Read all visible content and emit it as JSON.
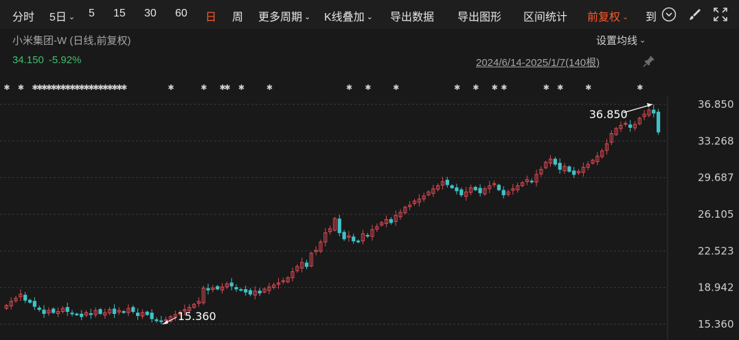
{
  "toolbar": {
    "periods": [
      "分时",
      "5日",
      "5",
      "15",
      "30",
      "60",
      "日",
      "周"
    ],
    "more_periods": "更多周期",
    "k_overlay": "K线叠加",
    "export_data": "导出数据",
    "export_chart": "导出图形",
    "range_stats": "区间统计",
    "adjust": "前复权",
    "goto": "到",
    "icons": [
      "clock-icon",
      "brush-icon",
      "fullscreen-icon"
    ]
  },
  "header": {
    "stock_name": "小米集团-W (日线,前复权)",
    "price": "34.150",
    "change_pct": "-5.92%",
    "ma_settings": "设置均线",
    "date_range": "2024/6/14-2025/1/7(140根)"
  },
  "colors": {
    "up": "#e04a55",
    "down": "#3fc3c8",
    "grid": "#3a3a3a",
    "active": "#ff5a2a",
    "change_negative": "#3fbf6f"
  },
  "chart_data": {
    "type": "candlestick",
    "title": "小米集团-W (日线,前复权)",
    "date_range": "2024/6/14-2025/1/7",
    "bar_count": 140,
    "y_ticks": [
      "36.850",
      "33.268",
      "29.687",
      "26.105",
      "22.523",
      "18.942",
      "15.360"
    ],
    "ylim": [
      15.36,
      36.85
    ],
    "grid": true,
    "annotations": [
      {
        "label": "36.850",
        "type": "high"
      },
      {
        "label": "15.360",
        "type": "low"
      }
    ],
    "closes": [
      17.2,
      17.6,
      17.9,
      18.3,
      17.7,
      17.5,
      17.1,
      16.8,
      16.4,
      16.7,
      16.5,
      16.6,
      16.9,
      16.6,
      16.4,
      16.3,
      16.1,
      16.5,
      16.3,
      16.7,
      16.4,
      16.5,
      16.8,
      16.4,
      16.7,
      16.5,
      16.9,
      16.6,
      16.2,
      16.5,
      16.3,
      15.9,
      15.7,
      15.6,
      15.8,
      16.1,
      16.3,
      16.5,
      16.8,
      17.0,
      17.3,
      17.6,
      18.9,
      18.7,
      18.9,
      18.8,
      19.0,
      19.3,
      19.1,
      18.8,
      18.7,
      18.5,
      18.3,
      18.6,
      18.4,
      18.8,
      19.0,
      19.2,
      19.4,
      19.6,
      19.9,
      20.5,
      21.0,
      21.4,
      21.0,
      22.3,
      22.6,
      23.4,
      24.3,
      24.7,
      25.7,
      24.3,
      23.7,
      24.0,
      23.5,
      23.4,
      24.2,
      24.0,
      24.6,
      24.9,
      25.3,
      25.6,
      25.3,
      26.0,
      26.3,
      26.8,
      27.0,
      27.4,
      27.6,
      27.9,
      28.3,
      28.6,
      28.9,
      29.3,
      29.0,
      28.7,
      28.4,
      28.0,
      28.3,
      28.7,
      28.5,
      28.2,
      28.6,
      28.9,
      29.1,
      28.5,
      28.0,
      28.3,
      28.6,
      28.9,
      29.2,
      29.5,
      29.3,
      30.0,
      30.5,
      31.2,
      31.5,
      31.0,
      30.5,
      30.8,
      30.3,
      30.0,
      30.3,
      30.7,
      31.0,
      31.4,
      31.8,
      32.3,
      33.0,
      34.0,
      34.5,
      34.8,
      35.0,
      34.6,
      34.9,
      35.5,
      35.9,
      36.3,
      36.0,
      34.15
    ]
  }
}
